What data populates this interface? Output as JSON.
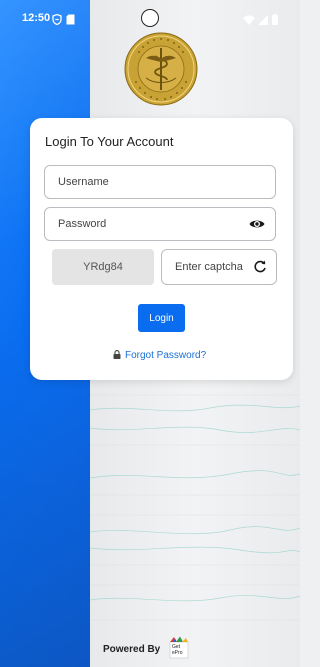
{
  "status_bar": {
    "time": "12:50",
    "icons": [
      "shield-icon",
      "sd-card-icon",
      "wifi-icon",
      "signal-icon",
      "battery-icon"
    ]
  },
  "logo": {
    "name": "institute-seal",
    "colors": {
      "gold": "#c9a236",
      "dark": "#8a6a14"
    }
  },
  "login_card": {
    "title": "Login To Your Account",
    "username": {
      "placeholder": "Username",
      "value": ""
    },
    "password": {
      "placeholder": "Password",
      "value": ""
    },
    "captcha": {
      "code": "YRdg84",
      "placeholder": "Enter captcha",
      "value": ""
    },
    "login_label": "Login",
    "forgot_label": "Forgot Password?"
  },
  "footer": {
    "powered_by": "Powered By",
    "brand_text": "Get\nePro"
  },
  "colors": {
    "accent": "#0a6df0",
    "link": "#1a6fd6",
    "left_panel": "#0a6df0"
  }
}
